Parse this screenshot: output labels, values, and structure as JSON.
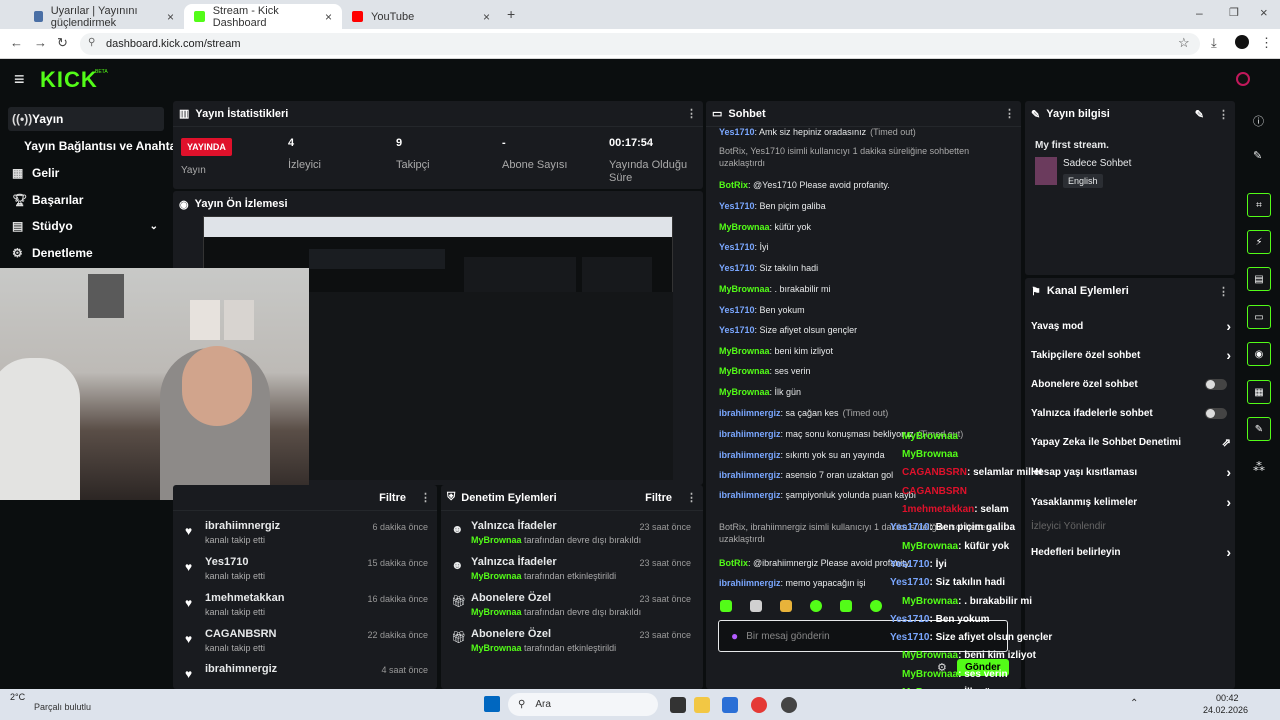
{
  "browser": {
    "tabs": [
      {
        "title": "Uyarılar | Yayınını güçlendirmek",
        "color": "#4a6fa5"
      },
      {
        "title": "Stream - Kick Dashboard",
        "color": "#53fc18"
      },
      {
        "title": "YouTube",
        "color": "#ff0000"
      }
    ],
    "url": "dashboard.kick.com/stream"
  },
  "app": {
    "logo": "KICK",
    "logo_sup": "BETA"
  },
  "sidebar": {
    "items": [
      {
        "label": "Yayın",
        "icon": "broadcast-icon"
      },
      {
        "label": "Yayın Bağlantısı ve Anahtarı",
        "icon": ""
      },
      {
        "label": "Gelir",
        "icon": "chart-icon"
      },
      {
        "label": "Başarılar",
        "icon": "trophy-icon"
      },
      {
        "label": "Stüdyo",
        "icon": "studio-icon"
      },
      {
        "label": "Denetleme",
        "icon": "shield-icon"
      }
    ]
  },
  "stats": {
    "title": "Yayın İstatistikleri",
    "live_badge": "YAYINDA",
    "live_label": "Yayın",
    "items": [
      {
        "value": "4",
        "label": "İzleyici"
      },
      {
        "value": "9",
        "label": "Takipçi"
      },
      {
        "value": "-",
        "label": "Abone Sayısı"
      },
      {
        "value": "00:17:54",
        "label": "Yayında Olduğu Süre"
      }
    ]
  },
  "preview": {
    "title": "Yayın Ön İzlemesi"
  },
  "followers": {
    "filter": "Filtre",
    "items": [
      {
        "name": "ibrahiimnergiz",
        "sub": "kanalı takip etti",
        "time": "6 dakika önce"
      },
      {
        "name": "Yes1710",
        "sub": "kanalı takip etti",
        "time": "15 dakika önce"
      },
      {
        "name": "1mehmetakkan",
        "sub": "kanalı takip etti",
        "time": "16 dakika önce"
      },
      {
        "name": "CAGANBSRN",
        "sub": "kanalı takip etti",
        "time": "22 dakika önce"
      },
      {
        "name": "ibrahimnergiz",
        "sub": "",
        "time": "4 saat önce"
      }
    ]
  },
  "moderation": {
    "title": "Denetim Eylemleri",
    "filter": "Filtre",
    "items": [
      {
        "name": "Yalnızca İfadeler",
        "by": "MyBrownaa",
        "sub": "tarafından devre dışı bırakıldı",
        "time": "23 saat önce"
      },
      {
        "name": "Yalnızca İfadeler",
        "by": "MyBrownaa",
        "sub": "tarafından etkinleştirildi",
        "time": "23 saat önce"
      },
      {
        "name": "Abonelere Özel",
        "by": "MyBrownaa",
        "sub": "tarafından devre dışı bırakıldı",
        "time": "23 saat önce"
      },
      {
        "name": "Abonelere Özel",
        "by": "MyBrownaa",
        "sub": "tarafından etkinleştirildi",
        "time": "23 saat önce"
      }
    ]
  },
  "chat": {
    "title": "Sohbet",
    "placeholder": "Bir mesaj gönderin",
    "send": "Gönder",
    "messages": [
      {
        "user": "Yes1710",
        "text": ": Amk siz hepiniz oradasınız",
        "note": "(Timed out)"
      },
      {
        "user": "",
        "text": "BotRix, Yes1710 isimli kullanıcıyı 1 dakika süreliğine sohbetten uzaklaştırdı",
        "note": ""
      },
      {
        "user": "BotRix",
        "text": ": @Yes1710 Please avoid profanity.",
        "note": ""
      },
      {
        "user": "Yes1710",
        "text": ": Ben piçim galiba",
        "note": ""
      },
      {
        "user": "MyBrownaa",
        "text": ": küfür yok",
        "note": ""
      },
      {
        "user": "Yes1710",
        "text": ": İyi",
        "note": ""
      },
      {
        "user": "Yes1710",
        "text": ": Siz takılın hadi",
        "note": ""
      },
      {
        "user": "MyBrownaa",
        "text": ": . bırakabilir mi",
        "note": ""
      },
      {
        "user": "Yes1710",
        "text": ": Ben yokum",
        "note": ""
      },
      {
        "user": "Yes1710",
        "text": ": Size afiyet olsun gençler",
        "note": ""
      },
      {
        "user": "MyBrownaa",
        "text": ": beni kim izliyot",
        "note": ""
      },
      {
        "user": "MyBrownaa",
        "text": ": ses verin",
        "note": ""
      },
      {
        "user": "MyBrownaa",
        "text": ": İlk gün",
        "note": ""
      },
      {
        "user": "ibrahiimnergiz",
        "text": ": sa çağan kes",
        "note": "(Timed out)"
      },
      {
        "user": "ibrahiimnergiz",
        "text": ": maç sonu konuşması bekliyoruz",
        "note": "(Timed out)"
      },
      {
        "user": "ibrahiimnergiz",
        "text": ": sıkıntı yok su an yayında",
        "note": ""
      },
      {
        "user": "ibrahiimnergiz",
        "text": ": asensio 7 oran uzaktan gol",
        "note": ""
      },
      {
        "user": "ibrahiimnergiz",
        "text": ": şampiyonluk yolunda puan kaybı",
        "note": ""
      },
      {
        "user": "",
        "text": "BotRix, ibrahiimnergiz isimli kullanıcıyı 1 dakika süreliğine sohbetten uzaklaştırdı",
        "note": ""
      },
      {
        "user": "BotRix",
        "text": ": @ibrahiimnergiz Please avoid profanity.",
        "note": ""
      },
      {
        "user": "ibrahiimnergiz",
        "text": ": memo yapacağın işi",
        "note": ""
      }
    ]
  },
  "stream_info": {
    "title": "Yayın bilgisi",
    "stream_title": "My first stream.",
    "category": "Sadece Sohbet",
    "language": "English"
  },
  "channel_actions": {
    "title": "Kanal Eylemleri",
    "items": [
      {
        "label": "Yavaş mod",
        "control": "chevron"
      },
      {
        "label": "Takipçilere özel sohbet",
        "control": "chevron"
      },
      {
        "label": "Abonelere özel sohbet",
        "control": "toggle"
      },
      {
        "label": "Yalnızca ifadelerle sohbet",
        "control": "toggle"
      },
      {
        "label": "Yapay Zeka ile Sohbet Denetimi",
        "control": "external"
      },
      {
        "label": "Hesap yaşı kısıtlaması",
        "control": "chevron"
      },
      {
        "label": "Yasaklanmış kelimeler",
        "control": "chevron"
      },
      {
        "label": "İzleyici Yönlendir",
        "control": "none"
      },
      {
        "label": "Hedefleri belirleyin",
        "control": "chevron"
      }
    ]
  },
  "overlay_chat": [
    {
      "user": "MyBrownaa",
      "text": ""
    },
    {
      "user": "MyBrownaa",
      "text": ""
    },
    {
      "user": "CAGANBSRN",
      "text": ": selamlar millet"
    },
    {
      "user": "CAGANBSRN",
      "text": ""
    },
    {
      "user": "1mehmetakkan",
      "text": ": selam"
    },
    {
      "user": "Yes1710",
      "text": ": Ben piçim galiba"
    },
    {
      "user": "MyBrownaa",
      "text": ": küfür yok"
    },
    {
      "user": "Yes1710",
      "text": ": İyi"
    },
    {
      "user": "Yes1710",
      "text": ": Siz takılın hadi"
    },
    {
      "user": "MyBrownaa",
      "text": ": . bırakabilir mi"
    },
    {
      "user": "Yes1710",
      "text": ": Ben yokum"
    },
    {
      "user": "Yes1710",
      "text": ": Size afiyet olsun gençler"
    },
    {
      "user": "MyBrownaa",
      "text": ": beni kim izliyot"
    },
    {
      "user": "MyBrownaa",
      "text": ": ses verin"
    },
    {
      "user": "MyBrownaa",
      "text": ": İlk gün"
    },
    {
      "user": "ibrahiimnergiz",
      "text": ": memo yapacağın işi"
    }
  ],
  "taskbar": {
    "weather_temp": "2°C",
    "weather_desc": "Parçalı bulutlu",
    "search": "Ara",
    "time": "00:42",
    "date": "24.02.2026"
  },
  "colors": {
    "accent": "#53fc18",
    "panel": "#191b1f",
    "bg": "#0b0e0f",
    "live": "#e0112b"
  }
}
